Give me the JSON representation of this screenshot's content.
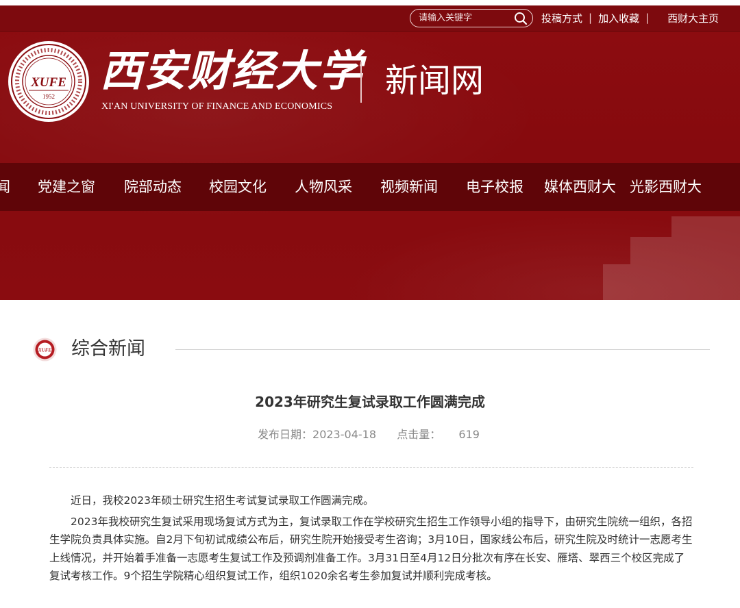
{
  "topbar": {
    "search_placeholder": "请输入关键字",
    "links": [
      {
        "label": "投稿方式"
      },
      {
        "label": "加入收藏"
      },
      {
        "label": "西财大主页"
      }
    ],
    "separator": "|"
  },
  "header": {
    "university_name": "西安财经大学",
    "university_name_en": "XI'AN UNIVERSITY OF FINANCE AND ECONOMICS",
    "site_name": "新闻网",
    "seal": {
      "abbr": "XUFE",
      "year": "1952"
    }
  },
  "nav": {
    "items": [
      {
        "label": "闻"
      },
      {
        "label": "党建之窗"
      },
      {
        "label": "院部动态"
      },
      {
        "label": "校园文化"
      },
      {
        "label": "人物风采"
      },
      {
        "label": "视频新闻"
      },
      {
        "label": "电子校报"
      },
      {
        "label": "媒体西财大"
      },
      {
        "label": "光影西财大"
      }
    ]
  },
  "section": {
    "title": "综合新闻",
    "seal_abbr": "XUFE"
  },
  "article": {
    "title": "2023年研究生复试录取工作圆满完成",
    "date_label": "发布日期：",
    "date": "2023-04-18",
    "views_label": "点击量：",
    "views": "619",
    "paragraphs": [
      "近日，我校2023年硕士研究生招生考试复试录取工作圆满完成。",
      "2023年我校研究生复试采用现场复试方式为主，复试录取工作在学校研究生招生工作领导小组的指导下，由研究生院统一组织，各招生学院负责具体实施。自2月下旬初试成绩公布后，研究生院开始接受考生咨询；3月10日，国家线公布后，研究生院及时统计一志愿考生上线情况，并开始着手准备一志愿考生复试工作及预调剂准备工作。3月31日至4月12日分批次有序在长安、雁塔、翠西三个校区完成了复试考核工作。9个招生学院精心组织复试工作，组织1020余名考生参加复试并顺利完成考核。"
    ]
  },
  "colors": {
    "brand_red": "#860a0e",
    "nav_dark": "#5f0508",
    "text_dark": "#333333",
    "text_meta": "#888888"
  }
}
